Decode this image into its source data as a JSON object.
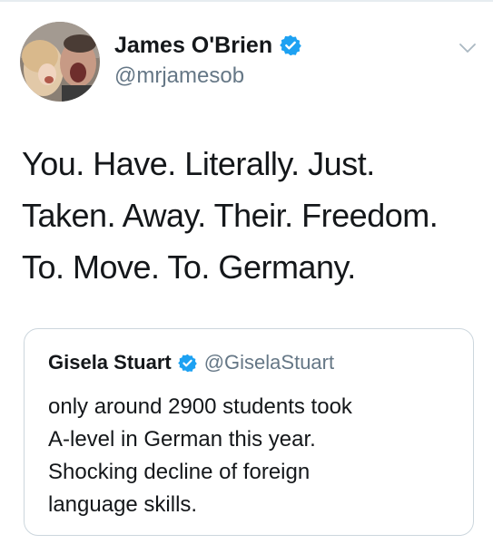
{
  "colors": {
    "text_primary": "#14171a",
    "text_secondary": "#657786",
    "verified_blue": "#1da1f2",
    "border": "#ccd6dd"
  },
  "author": {
    "display_name": "James O'Brien",
    "handle": "@mrjamesob",
    "verified_icon": "verified-badge-icon",
    "avatar_icon": "profile-photo"
  },
  "menu": {
    "icon": "chevron-down-icon"
  },
  "tweet": {
    "lines": [
      "You. Have. Literally. Just.",
      "Taken. Away. Their. Freedom.",
      "To. Move. To. Germany."
    ]
  },
  "quoted_tweet": {
    "display_name": "Gisela Stuart",
    "handle": "@GiselaStuart",
    "verified_icon": "verified-badge-icon",
    "lines": [
      "only around 2900 students took",
      "A-level in German this year.",
      "Shocking decline of foreign",
      "language skills."
    ]
  }
}
